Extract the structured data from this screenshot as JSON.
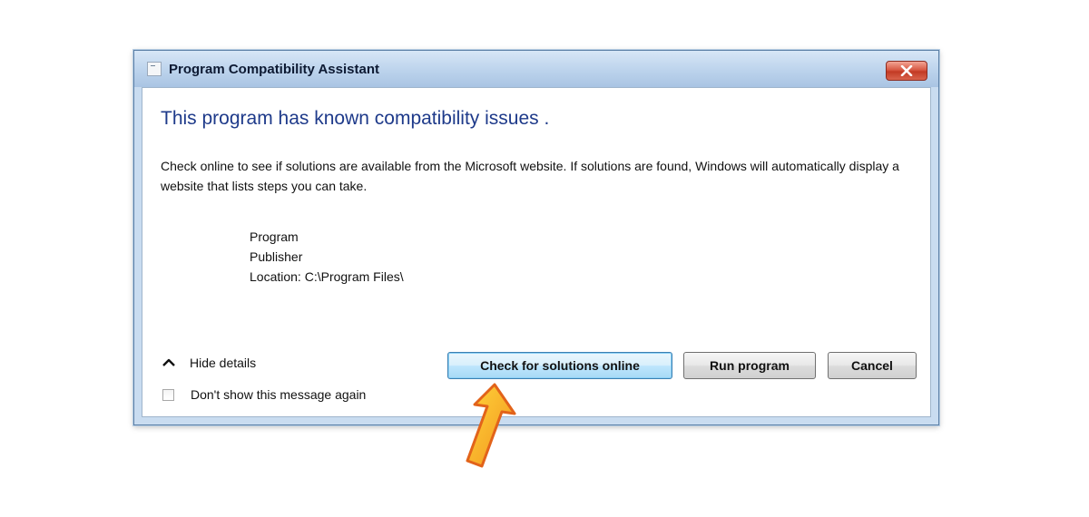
{
  "window": {
    "title": "Program Compatibility Assistant",
    "icons": {
      "app": "app-window-icon",
      "close": "close-icon"
    }
  },
  "content": {
    "heading": "This program has known compatibility issues .",
    "body": "Check online to see if solutions are available from the Microsoft website. If solutions are found, Windows will automatically display a website that lists steps you can take.",
    "details": {
      "program": "Program",
      "publisher": "Publisher",
      "location": "Location: C:\\Program Files\\"
    }
  },
  "footer": {
    "toggle_label": "Hide details",
    "toggle_icon": "chevron-up-icon",
    "checkbox_label": "Don't show this message again",
    "checkbox_checked": false,
    "buttons": {
      "check_online": "Check for solutions online",
      "run_program": "Run program",
      "cancel": "Cancel"
    }
  },
  "annotation": {
    "icon": "pointer-arrow-icon",
    "colors": {
      "outer": "#e8741a",
      "inner": "#ffd43a"
    }
  },
  "colors": {
    "heading": "#1e3a8a",
    "titlebar": "#bcd3ec",
    "close_button": "#c23a24",
    "default_button_border": "#3c7fb1"
  }
}
